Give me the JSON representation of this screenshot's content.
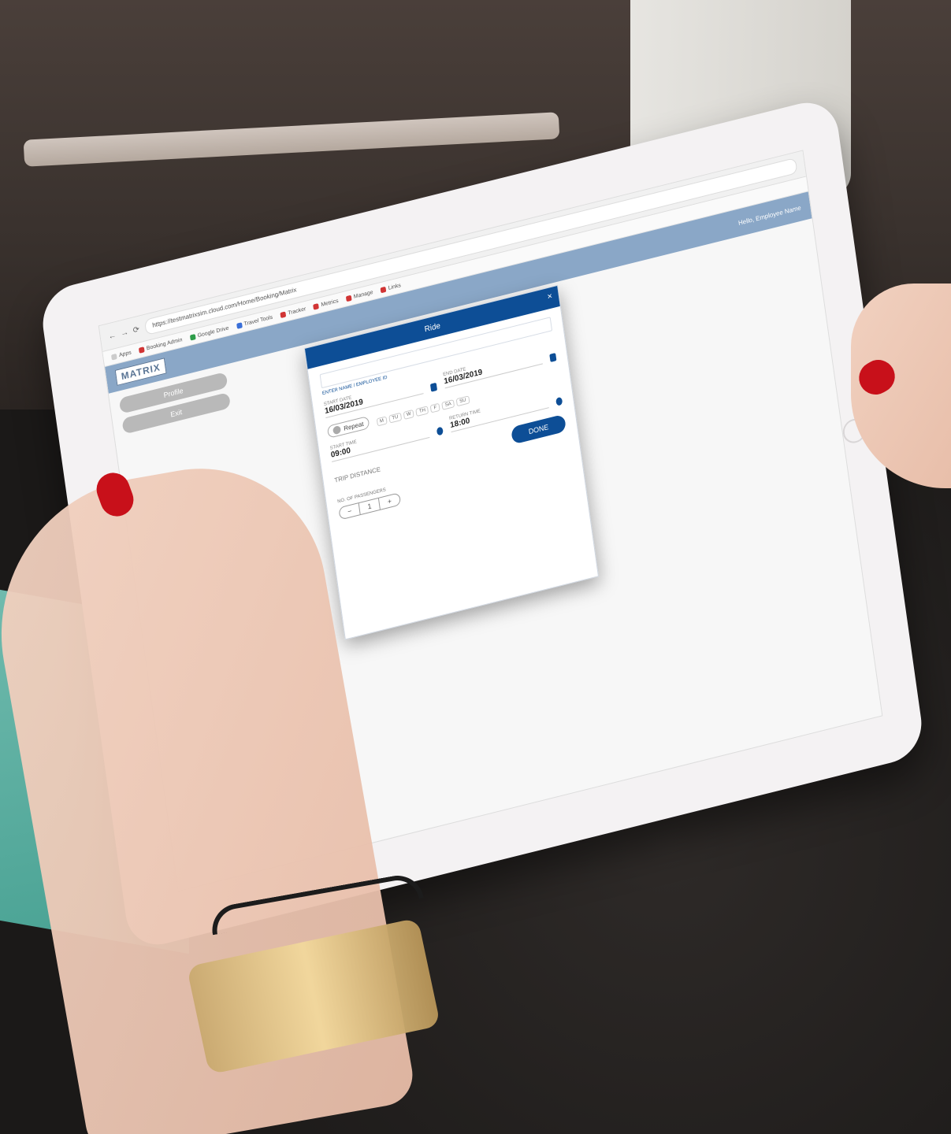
{
  "browser": {
    "nav": [
      "←",
      "→",
      "⟳"
    ],
    "url": "https://testmatrixsim.cloud.com/Home/Booking/Matrix"
  },
  "bookmarks": [
    {
      "label": "Apps",
      "color": "#cccccc"
    },
    {
      "label": "Booking Admin",
      "color": "#d13434"
    },
    {
      "label": "Google Drive",
      "color": "#2e9d4a"
    },
    {
      "label": "Travel Tools",
      "color": "#3a6fd8"
    },
    {
      "label": "Tracker",
      "color": "#d13434"
    },
    {
      "label": "Metrics",
      "color": "#d13434"
    },
    {
      "label": "Manage",
      "color": "#d13434"
    },
    {
      "label": "Links",
      "color": "#d13434"
    }
  ],
  "app": {
    "logo": "MATRIX",
    "user": "Hello, Employee Name"
  },
  "sidebar": {
    "items": [
      "Profile",
      "Exit"
    ]
  },
  "modal": {
    "title": "Ride",
    "close": "×",
    "search_hint": "ENTER NAME / EMPLOYEE ID",
    "start_date_label": "START DATE",
    "start_date_value": "16/03/2019",
    "end_date_label": "END DATE",
    "end_date_value": "16/03/2019",
    "repeat_label": "Repeat",
    "days": [
      "M",
      "TU",
      "W",
      "TH",
      "F",
      "SA",
      "SU"
    ],
    "return_time_label": "RETURN TIME",
    "return_time_value": "18:00",
    "start_time_label": "START TIME",
    "start_time_value": "09:00",
    "trip_distance_label": "TRIP DISTANCE",
    "done_label": "DONE",
    "passengers_label": "NO. OF PASSENGERS",
    "stepper": {
      "minus": "−",
      "value": "1",
      "plus": "+"
    }
  }
}
